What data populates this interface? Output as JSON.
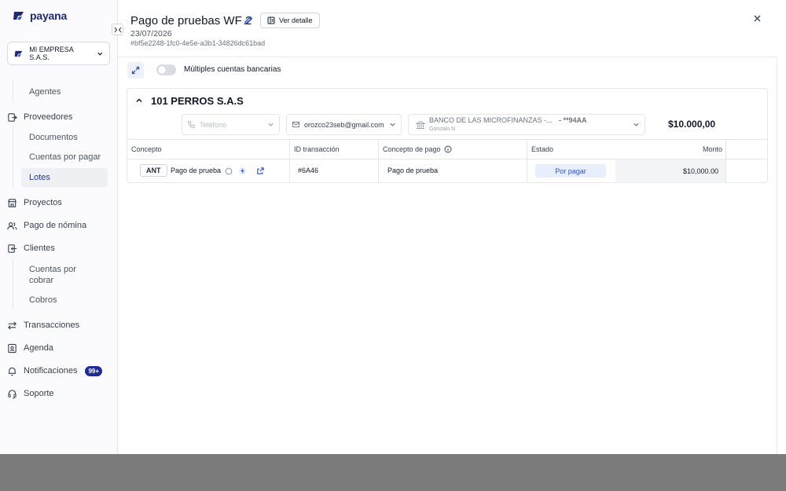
{
  "sidebar": {
    "logo_text": "payana",
    "company": "MI EMPRESA S.A.S.",
    "items": {
      "agentes": "Agentes",
      "proveedores": "Proveedores",
      "documentos": "Documentos",
      "cuentas_por_pagar": "Cuentas por pagar",
      "lotes": "Lotes",
      "proyectos": "Proyectos",
      "pago_nomina": "Pago de nómina",
      "clientes": "Clientes",
      "cuentas_por_cobrar_1": "Cuentas por",
      "cuentas_por_cobrar_2": "cobrar",
      "cobros": "Cobros",
      "transacciones": "Transacciones",
      "agenda": "Agenda",
      "notificaciones": "Notificaciones",
      "notificaciones_badge": "99+",
      "soporte": "Soporte"
    }
  },
  "header": {
    "title": "Pago de pruebas WF 2",
    "detail_button": "Ver detalle",
    "date": "23/07/2026",
    "uuid": "#bf5e2248-1fc0-4e5e-a3b1-34826dc61bad"
  },
  "toolbar": {
    "toggle_label": "Múltiples cuentas bancarias"
  },
  "vendor": {
    "name": "101 PERROS S.A.S",
    "phone_placeholder": "Teléfono",
    "email": "orozco23seb@gmail.com",
    "bank_name": "BANCO DE LAS MICROFINANZAS -...",
    "bank_account": "- **94AA",
    "bank_holder": "Gonzalo N",
    "total": "$10.000,00"
  },
  "table": {
    "headers": {
      "concepto": "Concepto",
      "id_transaccion": "ID transacción",
      "concepto_pago": "Concepto de pago",
      "estado": "Estado",
      "monto": "Monto"
    },
    "row": {
      "tag": "ANT",
      "concepto": "Pago de prueba",
      "id": "#6A46",
      "concepto_pago": "Pago de prueba",
      "estado": "Por pagar",
      "monto": "$10,000.00"
    }
  },
  "colors": {
    "brand": "#1e2a78",
    "status_bg": "#e8eefb",
    "status_text": "#2d50c8",
    "badge": "#1e2a9a"
  }
}
